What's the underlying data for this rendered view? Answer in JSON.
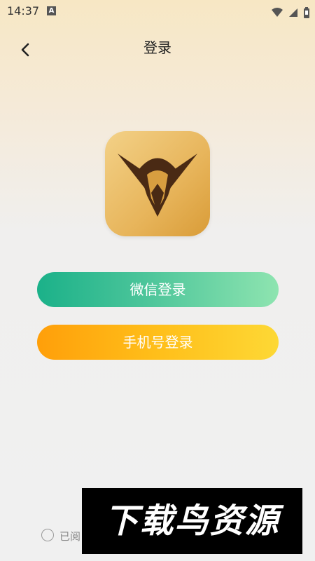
{
  "status_bar": {
    "time": "14:37",
    "notification_glyph": "A",
    "icons": [
      "wifi-icon",
      "signal-icon",
      "battery-icon"
    ]
  },
  "header": {
    "title": "登录",
    "back_icon": "chevron-left-icon"
  },
  "logo": {
    "icon": "app-logo-icon",
    "background_color": "#e7b45a",
    "mark_color": "#4a2a14"
  },
  "buttons": {
    "wechat_login": "微信登录",
    "phone_login": "手机号登录"
  },
  "agreement": {
    "text": "已阅"
  },
  "watermark": {
    "text": "下载鸟资源"
  },
  "colors": {
    "wechat_start": "#1bb189",
    "wechat_end": "#8ee4b0",
    "phone_start": "#ff9f0a",
    "phone_end": "#fdd835"
  }
}
